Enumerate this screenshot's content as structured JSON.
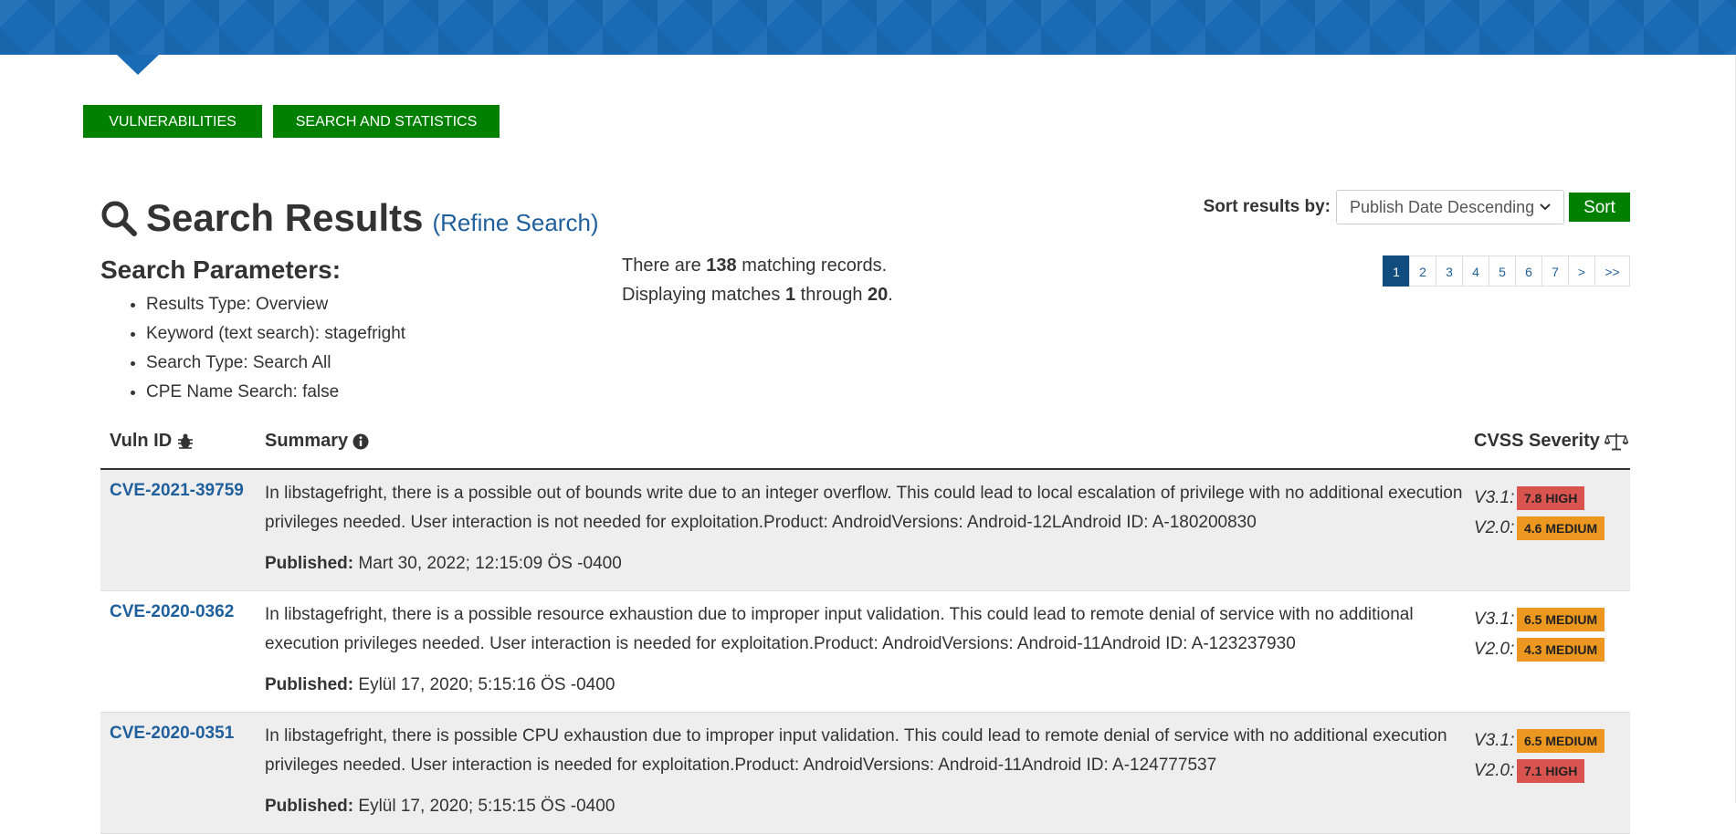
{
  "nav": {
    "vulnerabilities_label": "VULNERABILITIES",
    "stats_label": "SEARCH AND STATISTICS"
  },
  "header": {
    "title": "Search Results",
    "refine_label": "(Refine Search)",
    "search_icon": "search-icon"
  },
  "sort": {
    "label": "Sort results by:",
    "selected": "Publish Date Descending",
    "button_label": "Sort"
  },
  "params": {
    "heading": "Search Parameters:",
    "items": [
      "Results Type: Overview",
      "Keyword (text search): stagefright",
      "Search Type: Search All",
      "CPE Name Search: false"
    ]
  },
  "matches": {
    "prefix": "There are ",
    "total": "138",
    "suffix": " matching records.",
    "display_prefix": "Displaying matches ",
    "from": "1",
    "through_word": " through ",
    "to": "20",
    "end": "."
  },
  "pagination": {
    "pages": [
      "1",
      "2",
      "3",
      "4",
      "5",
      "6",
      "7",
      ">",
      ">>"
    ],
    "active": "1"
  },
  "table": {
    "headers": {
      "vuln_id": "Vuln ID",
      "summary": "Summary",
      "cvss": "CVSS Severity"
    },
    "published_label": "Published:",
    "rows": [
      {
        "id": "CVE-2021-39759",
        "summary": "In libstagefright, there is a possible out of bounds write due to an integer overflow. This could lead to local escalation of privilege with no additional execution privileges needed. User interaction is not needed for exploitation.Product: AndroidVersions: Android-12LAndroid ID: A-180200830",
        "published": "Mart 30, 2022; 12:15:09 ÖS -0400",
        "v31_label": "V3.1:",
        "v31": "7.8 HIGH",
        "v31_level": "high",
        "v20_label": "V2.0:",
        "v20": "4.6 MEDIUM",
        "v20_level": "medium"
      },
      {
        "id": "CVE-2020-0362",
        "summary": "In libstagefright, there is a possible resource exhaustion due to improper input validation. This could lead to remote denial of service with no additional execution privileges needed. User interaction is needed for exploitation.Product: AndroidVersions: Android-11Android ID: A-123237930",
        "published": "Eylül 17, 2020; 5:15:16 ÖS -0400",
        "v31_label": "V3.1:",
        "v31": "6.5 MEDIUM",
        "v31_level": "medium",
        "v20_label": "V2.0:",
        "v20": "4.3 MEDIUM",
        "v20_level": "medium"
      },
      {
        "id": "CVE-2020-0351",
        "summary": "In libstagefright, there is possible CPU exhaustion due to improper input validation. This could lead to remote denial of service with no additional execution privileges needed. User interaction is needed for exploitation.Product: AndroidVersions: Android-11Android ID: A-124777537",
        "published": "Eylül 17, 2020; 5:15:15 ÖS -0400",
        "v31_label": "V3.1:",
        "v31": "6.5 MEDIUM",
        "v31_level": "medium",
        "v20_label": "V2.0:",
        "v20": "7.1 HIGH",
        "v20_level": "high"
      }
    ]
  },
  "colors": {
    "banner": "#1a6bb5",
    "nav_green": "#008000",
    "link_blue": "#1f5f9c",
    "active_page": "#104c7d",
    "high": "#d9534f",
    "medium": "#ec971f"
  }
}
